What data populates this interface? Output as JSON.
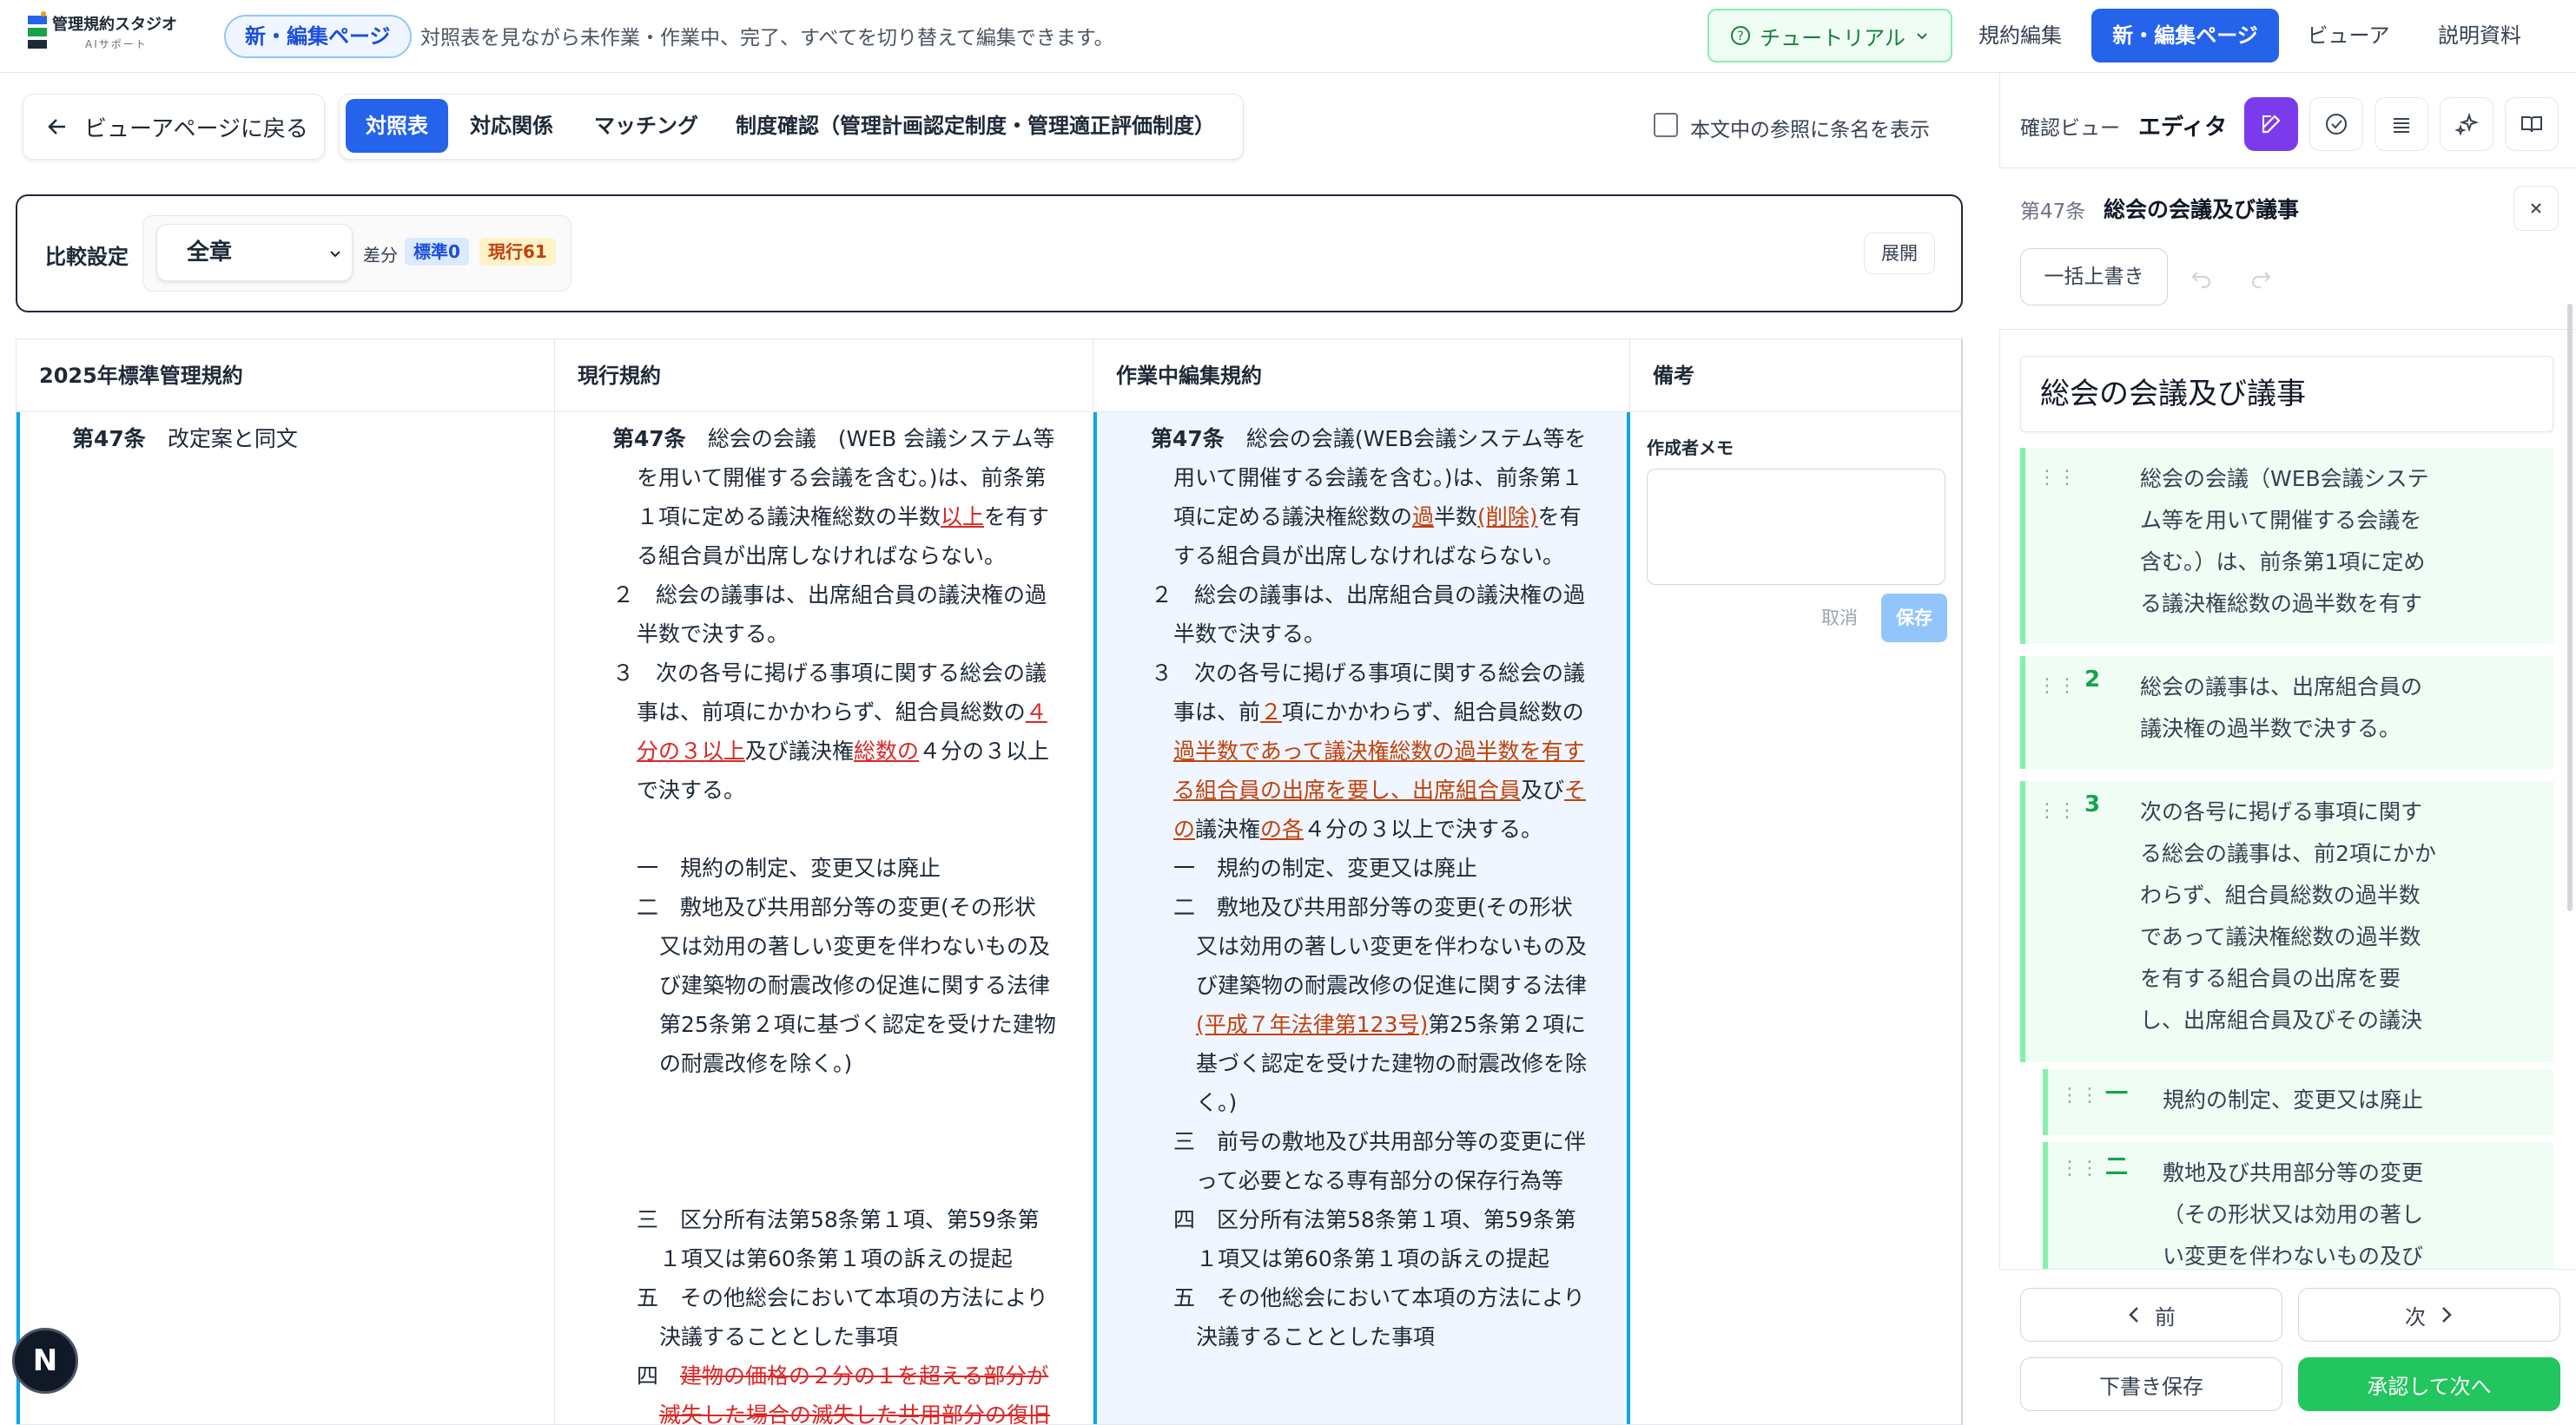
{
  "header": {
    "logo_title": "管理規約スタジオ",
    "logo_sub": "AIサポート",
    "mode_pill": "新・編集ページ",
    "description": "対照表を見ながら未作業・作業中、完了、すべてを切り替えて編集できます。",
    "tutorial": "チュートリアル",
    "nav": [
      "規約編集",
      "新・編集ページ",
      "ビューア",
      "説明資料"
    ]
  },
  "toolbar": {
    "back": "ビューアページに戻る",
    "tabs": [
      "対照表",
      "対応関係",
      "マッチング",
      "制度確認（管理計画認定制度・管理適正評価制度）"
    ],
    "show_names": "本文中の参照に条名を表示"
  },
  "compare": {
    "label": "比較設定",
    "scope": "全章",
    "diff_label": "差分",
    "std_badge": "標準0",
    "cur_badge": "現行61",
    "expand": "展開"
  },
  "table": {
    "headers": [
      "2025年標準管理規約",
      "現行規約",
      "作業中編集規約",
      "備考"
    ],
    "std": {
      "num": "第47条",
      "text": "改定案と同文"
    },
    "current": {
      "l1_num": "第47条",
      "l1_a": "総会の会議　(WEB 会議システム等",
      "l2": "を用いて開催する会議を含む。)は、前条第",
      "l3_a": "１項に定める議決権総数の半数",
      "l3_red": "以上",
      "l3_b": "を有す",
      "l4": "る組合員が出席しなければならない。",
      "p2_a": "２　総会の議事は、出席組合員の議決権の過",
      "p2_b": "半数で決する。",
      "p3_a": "３　次の各号に掲げる事項に関する総会の議",
      "p3_b": "事は、前項にかかわらず、組合員総数の",
      "p3_b_red": "４",
      "p3_c_red": "分の３以上",
      "p3_c": "及び議決権",
      "p3_c_red2": "総数の",
      "p3_c2": "４分の３以上",
      "p3_d": "で決する。",
      "i1": "一　規約の制定、変更又は廃止",
      "i2_a": "二　敷地及び共用部分等の変更(その形状",
      "i2_b": "又は効用の著しい変更を伴わないもの及",
      "i2_c": "び建築物の耐震改修の促進に関する法律",
      "i2_d": "第25条第２項に基づく認定を受けた建物",
      "i2_e": "の耐震改修を除く。)",
      "i3_a": "三　区分所有法第58条第１項、第59条第",
      "i3_b": "１項又は第60条第１項の訴えの提起",
      "i5_a": "五　その他総会において本項の方法により",
      "i5_b": "決議することとした事項",
      "i4_num": "四",
      "i4_a": "建物の価格の２分の１を超える部分が",
      "i4_b": "滅失した場合の滅失した共用部分の復旧"
    },
    "edit": {
      "l1_num": "第47条",
      "l1_a": "総会の会議(WEB会議システム等を",
      "l2": "用いて開催する会議を含む。)は、前条第１",
      "l3_a": "項に定める議決権総数の",
      "l3_o": "過",
      "l3_b": "半数",
      "l3_o2": "(削除)",
      "l3_c": "を有",
      "l4": "する組合員が出席しなければならない。",
      "p2_a": "２　総会の議事は、出席組合員の議決権の過",
      "p2_b": "半数で決する。",
      "p3_a": "３　次の各号に掲げる事項に関する総会の議",
      "p3_b_a": "事は、前",
      "p3_b_o": "２",
      "p3_b_b": "項にかかわらず、組合員総数の",
      "p3_c_o": "過半数であって議決権総数の過半数を有す",
      "p3_d_o": "る組合員の出席を要し、出席組合員",
      "p3_d_b": "及び",
      "p3_d_o2": "そ",
      "p3_e_o": "の",
      "p3_e_a": "議決権",
      "p3_e_o2": "の各",
      "p3_e_b": "４分の３以上で決する。",
      "i1": "一　規約の制定、変更又は廃止",
      "i2_a": "二　敷地及び共用部分等の変更(その形状",
      "i2_b": "又は効用の著しい変更を伴わないもの及",
      "i2_c": "び建築物の耐震改修の促進に関する法律",
      "i2_d_o": "(平成７年法律第123号)",
      "i2_d": "第25条第２項に",
      "i2_e": "基づく認定を受けた建物の耐震改修を除",
      "i2_f": "く。)",
      "i3_a": "三　前号の敷地及び共用部分等の変更に伴",
      "i3_b": "って必要となる専有部分の保存行為等",
      "i4_a": "四　区分所有法第58条第１項、第59条第",
      "i4_b": "１項又は第60条第１項の訴えの提起",
      "i5_a": "五　その他総会において本項の方法により",
      "i5_b": "決議することとした事項"
    },
    "memo": {
      "label": "作成者メモ",
      "cancel": "取消",
      "save": "保存"
    }
  },
  "panel": {
    "view_label": "確認ビュー",
    "editor_label": "エディタ",
    "article_num": "第47条",
    "article_title": "総会の会議及び議事",
    "bulk": "一括上書き",
    "title_field": "総会の会議及び議事",
    "blocks": [
      {
        "num": "",
        "lines": [
          "総会の会議（WEB会議システ",
          "ム等を用いて開催する会議を",
          "含む。）は、前条第1項に定め",
          "る議決権総数の過半数を有す"
        ]
      },
      {
        "num": "2",
        "lines": [
          "総会の議事は、出席組合員の",
          "議決権の過半数で決する。"
        ]
      },
      {
        "num": "3",
        "lines": [
          "次の各号に掲げる事項に関す",
          "る総会の議事は、前2項にかか",
          "わらず、組合員総数の過半数",
          "であって議決権総数の過半数",
          "を有する組合員の出席を要",
          "し、出席組合員及びその議決"
        ]
      }
    ],
    "items": [
      {
        "num": "一",
        "lines": [
          "規約の制定、変更又は廃止"
        ]
      },
      {
        "num": "二",
        "lines": [
          "敷地及び共用部分等の変更",
          "（その形状又は効用の著し",
          "い変更を伴わないもの及び"
        ]
      }
    ],
    "prev": "前",
    "next": "次",
    "draft": "下書き保存",
    "approve": "承認して次へ"
  },
  "colors": {
    "accent": "#2563eb",
    "green": "#16a34a",
    "red": "#dc2626",
    "orange": "#c2410c",
    "purple": "#7c3aed"
  }
}
